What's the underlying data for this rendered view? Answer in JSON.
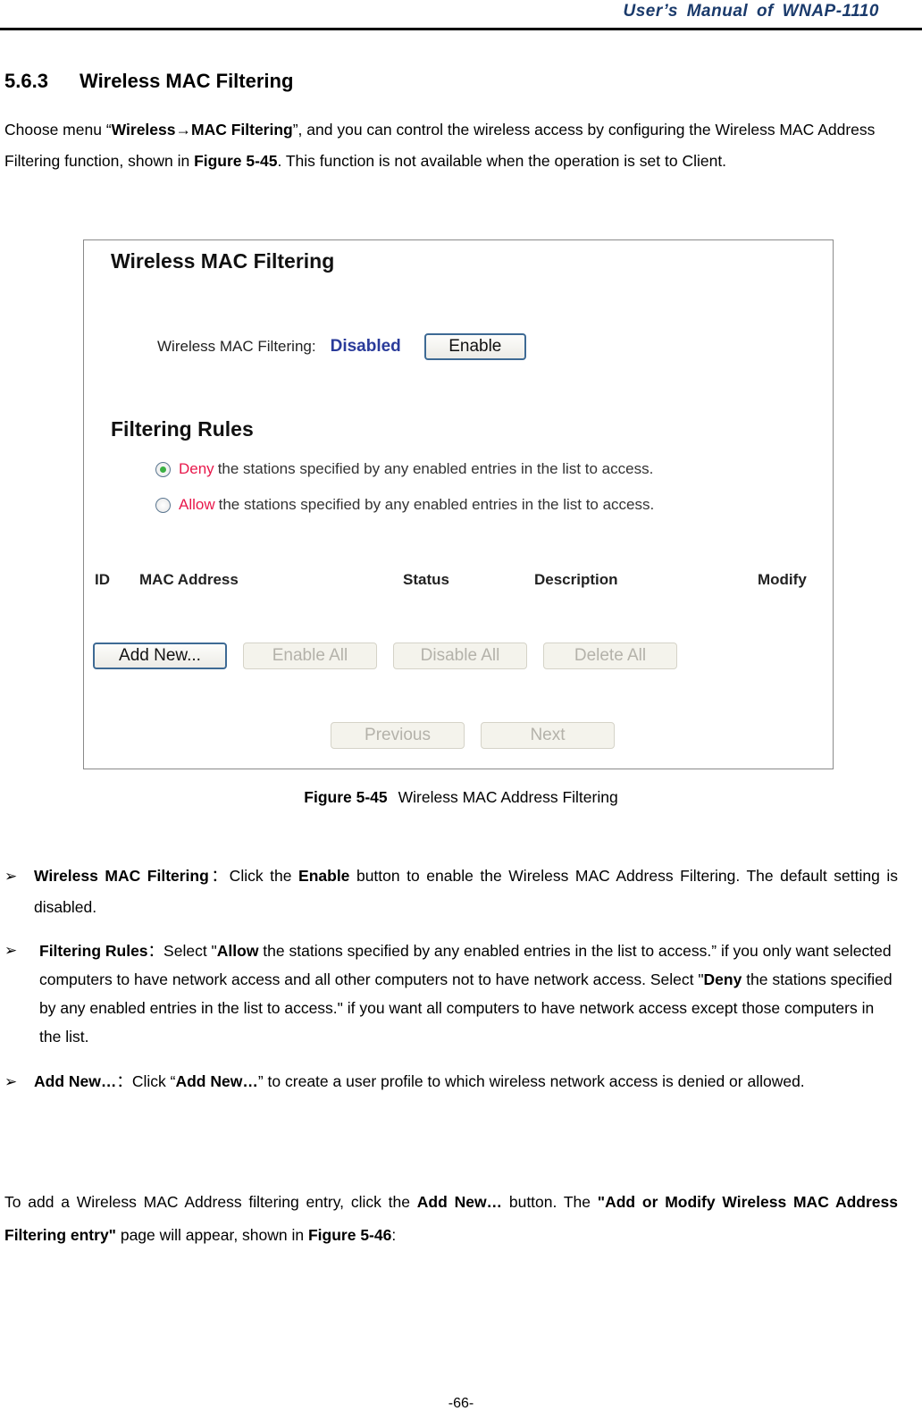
{
  "header": {
    "title": "User’s  Manual  of  WNAP-1110"
  },
  "section": {
    "number": "5.6.3",
    "title": "Wireless MAC Filtering",
    "intro": {
      "p1": "Choose menu “",
      "menu_path": "Wireless→MAC Filtering",
      "p2": "”, and you can control the wireless access by configuring the Wireless MAC Address Filtering function, shown in ",
      "figure_ref": "Figure 5-45",
      "p3": ". This function is not available when the operation is set to Client."
    }
  },
  "figure": {
    "title": "Wireless MAC Filtering",
    "status_label": "Wireless MAC Filtering:",
    "status_value": "Disabled",
    "enable_button": "Enable",
    "rules_title": "Filtering Rules",
    "rules": [
      {
        "keyword": "Deny",
        "text": "the stations specified by any enabled entries in the list to access.",
        "selected": true
      },
      {
        "keyword": "Allow",
        "text": "the stations specified by any enabled entries in the list to access.",
        "selected": false
      }
    ],
    "table_headers": [
      "ID",
      "MAC Address",
      "Status",
      "Description",
      "Modify"
    ],
    "actions": [
      "Add New...",
      "Enable All",
      "Disable All",
      "Delete All"
    ],
    "nav": [
      "Previous",
      "Next"
    ],
    "colors": {
      "status": "#2a3b9a",
      "keyword": "#e8184b",
      "radio_selected": "#3cb043"
    }
  },
  "caption": {
    "label": "Figure 5-45",
    "text": "Wireless MAC Address Filtering"
  },
  "bullets": [
    {
      "term": "Wireless MAC Filtering",
      "sep": "：Click the ",
      "b1": "Enable",
      "rest": " button to enable the Wireless MAC Address Filtering. The default setting is disabled."
    },
    {
      "term": "Filtering Rules",
      "sep": "：Select \"",
      "b1": "Allow",
      "mid": " the stations specified by any enabled entries in the list to access.” if you only want selected computers to have network access and all other computers not to have network access. Select \"",
      "b2": "Deny",
      "rest": " the stations specified by any enabled entries in the list to access.\" if you want all computers to have network access except those computers in the list."
    },
    {
      "term": "Add New…",
      "sep": "：Click “",
      "b1": "Add New…",
      "rest": "” to create a user profile to which wireless network access is denied or allowed."
    }
  ],
  "outro": {
    "p1": "To add a Wireless MAC Address filtering entry, click the ",
    "b1": "Add New…",
    "p2": " button. The ",
    "b2": "\"Add or Modify Wireless MAC Address Filtering entry\"",
    "p3": " page will appear, shown in ",
    "b3": "Figure 5-46",
    "p4": ":"
  },
  "page_number": "-66-"
}
